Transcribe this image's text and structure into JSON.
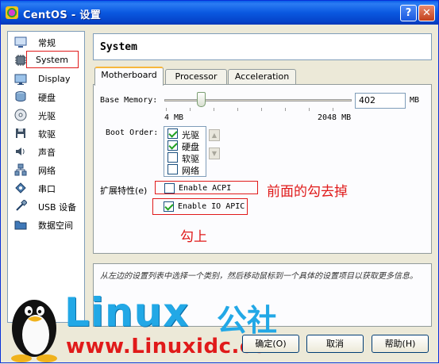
{
  "window": {
    "title": "CentOS - 设置",
    "help_glyph": "?",
    "close_glyph": "✕"
  },
  "sidebar": {
    "items": [
      {
        "label": "常规",
        "icon": "general-icon"
      },
      {
        "label": "System",
        "icon": "system-icon",
        "selected": true
      },
      {
        "label": "Display",
        "icon": "display-icon"
      },
      {
        "label": "硬盘",
        "icon": "harddisk-icon"
      },
      {
        "label": "光驱",
        "icon": "cdrom-icon"
      },
      {
        "label": "软驱",
        "icon": "floppy-icon"
      },
      {
        "label": "声音",
        "icon": "audio-icon"
      },
      {
        "label": "网络",
        "icon": "network-icon"
      },
      {
        "label": "串口",
        "icon": "serial-icon"
      },
      {
        "label": "USB 设备",
        "icon": "usb-icon"
      },
      {
        "label": "数据空间",
        "icon": "shared-folder-icon"
      }
    ]
  },
  "header": {
    "title": "System"
  },
  "tabs": [
    {
      "label": "Motherboard",
      "active": true
    },
    {
      "label": "Processor",
      "active": false
    },
    {
      "label": "Acceleration",
      "active": false
    }
  ],
  "motherboard": {
    "base_memory_label": "Base Memory:",
    "base_memory_value": "402",
    "base_memory_unit": "MB",
    "slider_min_label": "4 MB",
    "slider_max_label": "2048 MB",
    "slider_fraction": 0.196,
    "boot_order_label": "Boot Order:",
    "boot_items": [
      {
        "label": "光驱",
        "checked": true
      },
      {
        "label": "硬盘",
        "checked": true
      },
      {
        "label": "软驱",
        "checked": false
      },
      {
        "label": "网络",
        "checked": false
      }
    ],
    "extended_features_label": "扩展特性(e)",
    "acpi_label": "Enable ACPI",
    "acpi_checked": false,
    "ioapic_label": "Enable IO APIC",
    "ioapic_checked": true
  },
  "annotations": {
    "acpi_note": "前面的勾去掉",
    "ioapic_note": "勾上"
  },
  "info": {
    "text": "从左边的设置列表中选择一个类别，然后移动鼠标到一个具体的设置项目以获取更多信息。"
  },
  "buttons": {
    "ok": "确定(O)",
    "cancel": "取消",
    "help": "帮助(H)"
  },
  "watermark": {
    "brand": "Linux",
    "brand_cn": "公社",
    "url": "www.Linuxidc.com"
  },
  "colors": {
    "accent_red": "#e01a1a",
    "titlebar_blue": "#0a58e0",
    "watermark_blue": "#22a8e6"
  }
}
